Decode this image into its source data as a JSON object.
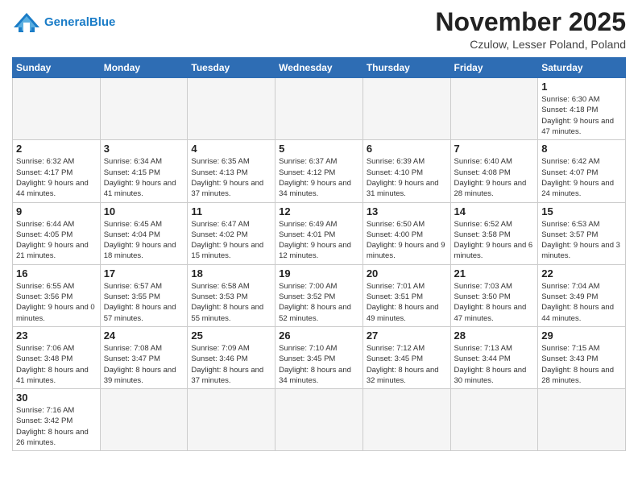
{
  "logo": {
    "line1": "General",
    "line2": "Blue"
  },
  "title": "November 2025",
  "subtitle": "Czulow, Lesser Poland, Poland",
  "weekdays": [
    "Sunday",
    "Monday",
    "Tuesday",
    "Wednesday",
    "Thursday",
    "Friday",
    "Saturday"
  ],
  "days": [
    {
      "day": "",
      "info": ""
    },
    {
      "day": "",
      "info": ""
    },
    {
      "day": "",
      "info": ""
    },
    {
      "day": "",
      "info": ""
    },
    {
      "day": "",
      "info": ""
    },
    {
      "day": "",
      "info": ""
    },
    {
      "day": "1",
      "info": "Sunrise: 6:30 AM\nSunset: 4:18 PM\nDaylight: 9 hours and 47 minutes."
    },
    {
      "day": "2",
      "info": "Sunrise: 6:32 AM\nSunset: 4:17 PM\nDaylight: 9 hours and 44 minutes."
    },
    {
      "day": "3",
      "info": "Sunrise: 6:34 AM\nSunset: 4:15 PM\nDaylight: 9 hours and 41 minutes."
    },
    {
      "day": "4",
      "info": "Sunrise: 6:35 AM\nSunset: 4:13 PM\nDaylight: 9 hours and 37 minutes."
    },
    {
      "day": "5",
      "info": "Sunrise: 6:37 AM\nSunset: 4:12 PM\nDaylight: 9 hours and 34 minutes."
    },
    {
      "day": "6",
      "info": "Sunrise: 6:39 AM\nSunset: 4:10 PM\nDaylight: 9 hours and 31 minutes."
    },
    {
      "day": "7",
      "info": "Sunrise: 6:40 AM\nSunset: 4:08 PM\nDaylight: 9 hours and 28 minutes."
    },
    {
      "day": "8",
      "info": "Sunrise: 6:42 AM\nSunset: 4:07 PM\nDaylight: 9 hours and 24 minutes."
    },
    {
      "day": "9",
      "info": "Sunrise: 6:44 AM\nSunset: 4:05 PM\nDaylight: 9 hours and 21 minutes."
    },
    {
      "day": "10",
      "info": "Sunrise: 6:45 AM\nSunset: 4:04 PM\nDaylight: 9 hours and 18 minutes."
    },
    {
      "day": "11",
      "info": "Sunrise: 6:47 AM\nSunset: 4:02 PM\nDaylight: 9 hours and 15 minutes."
    },
    {
      "day": "12",
      "info": "Sunrise: 6:49 AM\nSunset: 4:01 PM\nDaylight: 9 hours and 12 minutes."
    },
    {
      "day": "13",
      "info": "Sunrise: 6:50 AM\nSunset: 4:00 PM\nDaylight: 9 hours and 9 minutes."
    },
    {
      "day": "14",
      "info": "Sunrise: 6:52 AM\nSunset: 3:58 PM\nDaylight: 9 hours and 6 minutes."
    },
    {
      "day": "15",
      "info": "Sunrise: 6:53 AM\nSunset: 3:57 PM\nDaylight: 9 hours and 3 minutes."
    },
    {
      "day": "16",
      "info": "Sunrise: 6:55 AM\nSunset: 3:56 PM\nDaylight: 9 hours and 0 minutes."
    },
    {
      "day": "17",
      "info": "Sunrise: 6:57 AM\nSunset: 3:55 PM\nDaylight: 8 hours and 57 minutes."
    },
    {
      "day": "18",
      "info": "Sunrise: 6:58 AM\nSunset: 3:53 PM\nDaylight: 8 hours and 55 minutes."
    },
    {
      "day": "19",
      "info": "Sunrise: 7:00 AM\nSunset: 3:52 PM\nDaylight: 8 hours and 52 minutes."
    },
    {
      "day": "20",
      "info": "Sunrise: 7:01 AM\nSunset: 3:51 PM\nDaylight: 8 hours and 49 minutes."
    },
    {
      "day": "21",
      "info": "Sunrise: 7:03 AM\nSunset: 3:50 PM\nDaylight: 8 hours and 47 minutes."
    },
    {
      "day": "22",
      "info": "Sunrise: 7:04 AM\nSunset: 3:49 PM\nDaylight: 8 hours and 44 minutes."
    },
    {
      "day": "23",
      "info": "Sunrise: 7:06 AM\nSunset: 3:48 PM\nDaylight: 8 hours and 41 minutes."
    },
    {
      "day": "24",
      "info": "Sunrise: 7:08 AM\nSunset: 3:47 PM\nDaylight: 8 hours and 39 minutes."
    },
    {
      "day": "25",
      "info": "Sunrise: 7:09 AM\nSunset: 3:46 PM\nDaylight: 8 hours and 37 minutes."
    },
    {
      "day": "26",
      "info": "Sunrise: 7:10 AM\nSunset: 3:45 PM\nDaylight: 8 hours and 34 minutes."
    },
    {
      "day": "27",
      "info": "Sunrise: 7:12 AM\nSunset: 3:45 PM\nDaylight: 8 hours and 32 minutes."
    },
    {
      "day": "28",
      "info": "Sunrise: 7:13 AM\nSunset: 3:44 PM\nDaylight: 8 hours and 30 minutes."
    },
    {
      "day": "29",
      "info": "Sunrise: 7:15 AM\nSunset: 3:43 PM\nDaylight: 8 hours and 28 minutes."
    },
    {
      "day": "30",
      "info": "Sunrise: 7:16 AM\nSunset: 3:42 PM\nDaylight: 8 hours and 26 minutes."
    },
    {
      "day": "",
      "info": ""
    },
    {
      "day": "",
      "info": ""
    },
    {
      "day": "",
      "info": ""
    },
    {
      "day": "",
      "info": ""
    },
    {
      "day": "",
      "info": ""
    },
    {
      "day": "",
      "info": ""
    }
  ]
}
